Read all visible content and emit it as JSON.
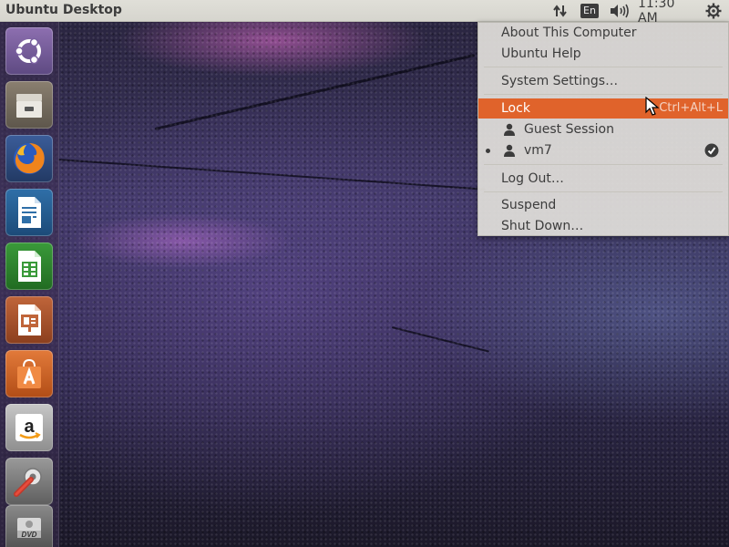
{
  "top_panel": {
    "title": "Ubuntu Desktop",
    "keyboard_layout": "En",
    "clock": "11:30 AM",
    "icons": [
      "network-icon",
      "volume-icon",
      "system-gear-icon"
    ]
  },
  "launcher": {
    "items": [
      {
        "name": "dash-home",
        "icon": "ubuntu-logo-icon"
      },
      {
        "name": "files",
        "icon": "file-cabinet-icon"
      },
      {
        "name": "firefox",
        "icon": "firefox-icon"
      },
      {
        "name": "libreoffice-writer",
        "icon": "writer-document-icon"
      },
      {
        "name": "libreoffice-calc",
        "icon": "calc-spreadsheet-icon"
      },
      {
        "name": "libreoffice-impress",
        "icon": "impress-presentation-icon"
      },
      {
        "name": "ubuntu-software",
        "icon": "software-bag-icon"
      },
      {
        "name": "amazon",
        "icon": "amazon-icon"
      },
      {
        "name": "system-settings",
        "icon": "settings-tools-icon"
      },
      {
        "name": "dvd",
        "icon": "dvd-drive-icon"
      }
    ]
  },
  "session_menu": {
    "about": "About This Computer",
    "help": "Ubuntu Help",
    "settings": "System Settings…",
    "lock": "Lock",
    "lock_shortcut": "Ctrl+Alt+L",
    "users": [
      {
        "name": "Guest Session",
        "current": false
      },
      {
        "name": "vm7",
        "current": true
      }
    ],
    "logout": "Log Out…",
    "suspend": "Suspend",
    "shutdown": "Shut Down…"
  },
  "colors": {
    "accent": "#e0632b",
    "panel": "#dcdbd4",
    "launcher": "#3c2d50"
  }
}
